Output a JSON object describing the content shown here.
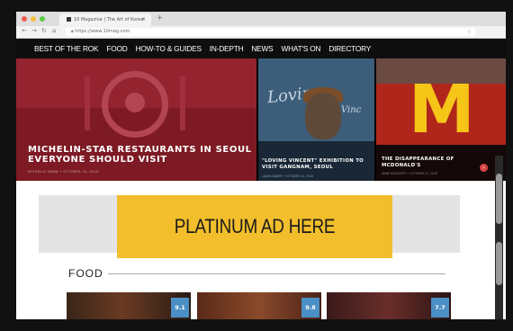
{
  "browser": {
    "tab_title": "10 Magazine | The Art of Korea",
    "new_tab_glyph": "+",
    "url": "https://www.10mag.com",
    "window_dot_colors": [
      "#ee5b54",
      "#f5bd3a",
      "#5ccb45"
    ]
  },
  "nav": {
    "items": [
      "BEST OF THE ROK",
      "FOOD",
      "HOW-TO & GUIDES",
      "IN-DEPTH",
      "NEWS",
      "WHAT'S ON",
      "DIRECTORY"
    ]
  },
  "hero": {
    "main": {
      "title": "MICHELIN-STAR RESTAURANTS IN SEOUL EVERYONE SHOULD VISIT",
      "meta": "MICHELLE MANN • OCTOBER 24, 2018"
    },
    "middle": {
      "title": "\"LOVING VINCENT\" EXHIBITION TO VISIT GANGNAM, SEOUL",
      "meta": "LAURA BAKER • OCTOBER 15, 2018",
      "scene_text": "Loving",
      "scene_text_2": "Vinc"
    },
    "right": {
      "title": "THE DISAPPEARANCE OF MCDONALD'S",
      "meta": "ANNE HAGGERTY • OCTOBER 12, 2018",
      "logo": "M"
    }
  },
  "ad": {
    "label": "PLATINUM AD HERE",
    "color": "#f2be2c"
  },
  "section": {
    "title": "FOOD",
    "cards": [
      {
        "score": "9.1"
      },
      {
        "score": "9.8"
      },
      {
        "score": "7.7"
      }
    ]
  },
  "colors": {
    "nav_bg": "#0e0e0e",
    "hero_main_bg": "#7d1a24",
    "score_badge": "#4a8fc6"
  }
}
